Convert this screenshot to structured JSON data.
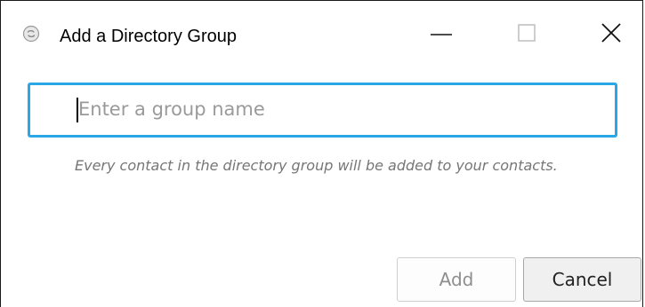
{
  "window": {
    "title": "Add a Directory Group",
    "icon": "app-logo-icon",
    "controls": {
      "minimize_icon": "minimize-icon",
      "maximize_icon": "maximize-icon",
      "close_icon": "close-icon"
    }
  },
  "group_name": {
    "value": "",
    "placeholder": "Enter a group name",
    "focused": true,
    "accent": "#2aa8e6"
  },
  "help_text": "Every contact in the directory group will be added to your contacts.",
  "buttons": {
    "add_label": "Add",
    "add_enabled": false,
    "cancel_label": "Cancel"
  }
}
